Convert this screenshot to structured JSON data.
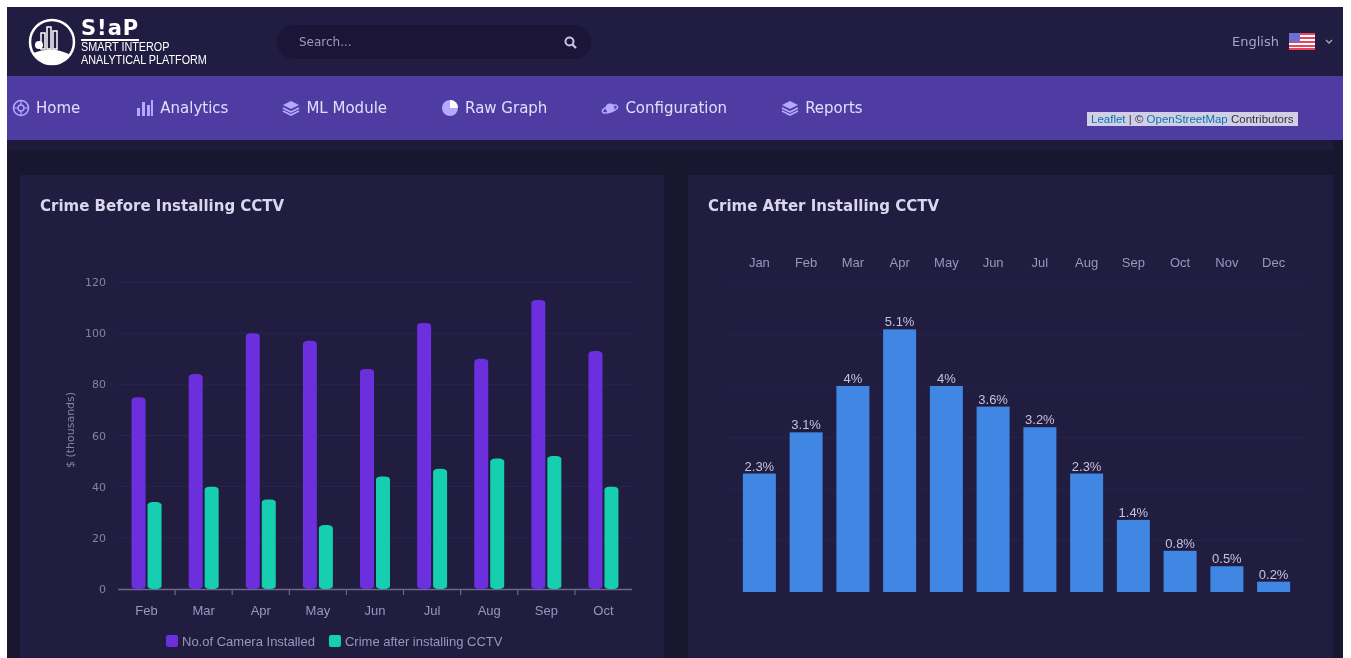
{
  "header": {
    "logo": {
      "wordmark": "S!aP",
      "tagline": [
        "SMART INTEROP",
        "ANALYTICAL PLATFORM"
      ]
    },
    "search": {
      "placeholder": "Search..."
    },
    "language": {
      "label": "English"
    }
  },
  "nav": {
    "items": [
      {
        "label": "Home"
      },
      {
        "label": "Analytics"
      },
      {
        "label": "ML Module"
      },
      {
        "label": "Raw Graph"
      },
      {
        "label": "Configuration"
      },
      {
        "label": "Reports"
      }
    ]
  },
  "map": {
    "attribution": [
      {
        "kind": "link",
        "text": "Leaflet"
      },
      {
        "kind": "text",
        "text": " | © "
      },
      {
        "kind": "link",
        "text": "OpenStreetMap"
      },
      {
        "kind": "text",
        "text": " Contributors"
      }
    ]
  },
  "cards": [
    {
      "title": "Crime Before Installing CCTV",
      "chart_data": {
        "type": "bar",
        "grid": true,
        "legend": "bottom",
        "ylabel": "$ (thousands)",
        "categories": [
          "Feb",
          "Mar",
          "Apr",
          "May",
          "Jun",
          "Jul",
          "Aug",
          "Sep",
          "Oct"
        ],
        "ylim": [
          0,
          120
        ],
        "yticks": [
          0,
          20,
          40,
          60,
          80,
          100,
          120
        ],
        "series": [
          {
            "name": "No.of Camera Installed",
            "color": "#6b2fde",
            "values": [
              75,
              84,
              100,
              97,
              86,
              104,
              90,
              113,
              93
            ]
          },
          {
            "name": "Crime after installing CCTV",
            "color": "#16cfb0",
            "values": [
              34,
              40,
              35,
              25,
              44,
              47,
              51,
              52,
              40
            ]
          }
        ]
      }
    },
    {
      "title": "Crime After Installing CCTV",
      "chart_data": {
        "type": "bar",
        "grid": true,
        "data_labels": true,
        "categories": [
          "Jan",
          "Feb",
          "Mar",
          "Apr",
          "May",
          "Jun",
          "Jul",
          "Aug",
          "Sep",
          "Oct",
          "Nov",
          "Dec"
        ],
        "series": [
          {
            "color": "#3f87e2",
            "values": [
              2.3,
              3.1,
              4,
              5.1,
              4,
              3.6,
              3.2,
              2.3,
              1.4,
              0.8,
              0.5,
              0.2
            ],
            "value_labels": [
              "2.3%",
              "3.1%",
              "4%",
              "5.1%",
              "4%",
              "3.6%",
              "3.2%",
              "2.3%",
              "1.4%",
              "0.8%",
              "0.5%",
              "0.2%"
            ]
          }
        ]
      }
    }
  ]
}
